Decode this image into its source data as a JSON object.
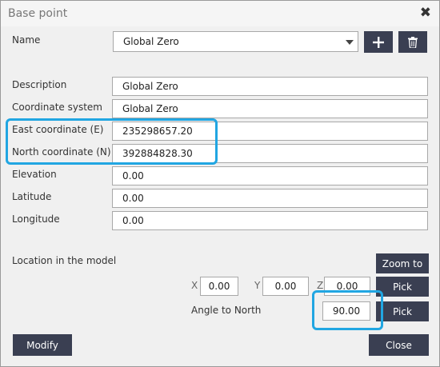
{
  "window": {
    "title": "Base point",
    "close_glyph": "✖"
  },
  "name_row": {
    "label": "Name",
    "selected": "Global Zero"
  },
  "fields": [
    {
      "label": "Description",
      "value": "Global Zero"
    },
    {
      "label": "Coordinate system",
      "value": "Global Zero"
    },
    {
      "label": "East coordinate  (E)",
      "value": "235298657.20"
    },
    {
      "label": "North coordinate  (N)",
      "value": "392884828.30"
    },
    {
      "label": "Elevation",
      "value": "0.00"
    },
    {
      "label": "Latitude",
      "value": "0.00"
    },
    {
      "label": "Longitude",
      "value": "0.00"
    }
  ],
  "location": {
    "label": "Location in the model",
    "x_label": "X",
    "x_value": "0.00",
    "y_label": "Y",
    "y_value": "0.00",
    "z_label": "Z",
    "z_value": "0.00",
    "angle_label": "Angle to North",
    "angle_value": "90.00"
  },
  "buttons": {
    "zoom_to": "Zoom to",
    "pick_1": "Pick",
    "pick_2": "Pick",
    "modify": "Modify",
    "close": "Close"
  },
  "icons": {
    "add": "plus-icon",
    "delete": "trash-icon",
    "dropdown": "chevron-down-icon"
  },
  "colors": {
    "button_bg": "#3a3f52",
    "highlight": "#21a6e2"
  }
}
